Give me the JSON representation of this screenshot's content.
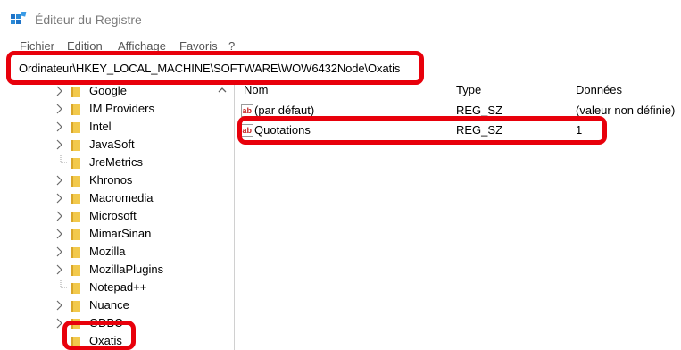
{
  "window": {
    "title": "Éditeur du Registre",
    "accent": "#e8000b",
    "folder_color": "#f2c94c"
  },
  "menu": [
    "Fichier",
    "Edition",
    "Affichage",
    "Favoris",
    "?"
  ],
  "address": {
    "path": "Ordinateur\\HKEY_LOCAL_MACHINE\\SOFTWARE\\WOW6432Node\\Oxatis"
  },
  "tree": {
    "items": [
      {
        "label": "Google",
        "expander": "chevron"
      },
      {
        "label": "IM Providers",
        "expander": "chevron"
      },
      {
        "label": "Intel",
        "expander": "chevron"
      },
      {
        "label": "JavaSoft",
        "expander": "chevron"
      },
      {
        "label": "JreMetrics",
        "expander": "line"
      },
      {
        "label": "Khronos",
        "expander": "chevron"
      },
      {
        "label": "Macromedia",
        "expander": "chevron"
      },
      {
        "label": "Microsoft",
        "expander": "chevron"
      },
      {
        "label": "MimarSinan",
        "expander": "chevron"
      },
      {
        "label": "Mozilla",
        "expander": "chevron"
      },
      {
        "label": "MozillaPlugins",
        "expander": "chevron"
      },
      {
        "label": "Notepad++",
        "expander": "line"
      },
      {
        "label": "Nuance",
        "expander": "chevron"
      },
      {
        "label": "ODBC",
        "expander": "chevron"
      },
      {
        "label": "Oxatis",
        "expander": "none"
      }
    ]
  },
  "values": {
    "columns": [
      "Nom",
      "Type",
      "Données"
    ],
    "rows": [
      {
        "name": "(par défaut)",
        "type": "REG_SZ",
        "data": "(valeur non définie)",
        "icon": "string-value-icon"
      },
      {
        "name": "Quotations",
        "type": "REG_SZ",
        "data": "1",
        "icon": "string-value-icon"
      }
    ]
  }
}
